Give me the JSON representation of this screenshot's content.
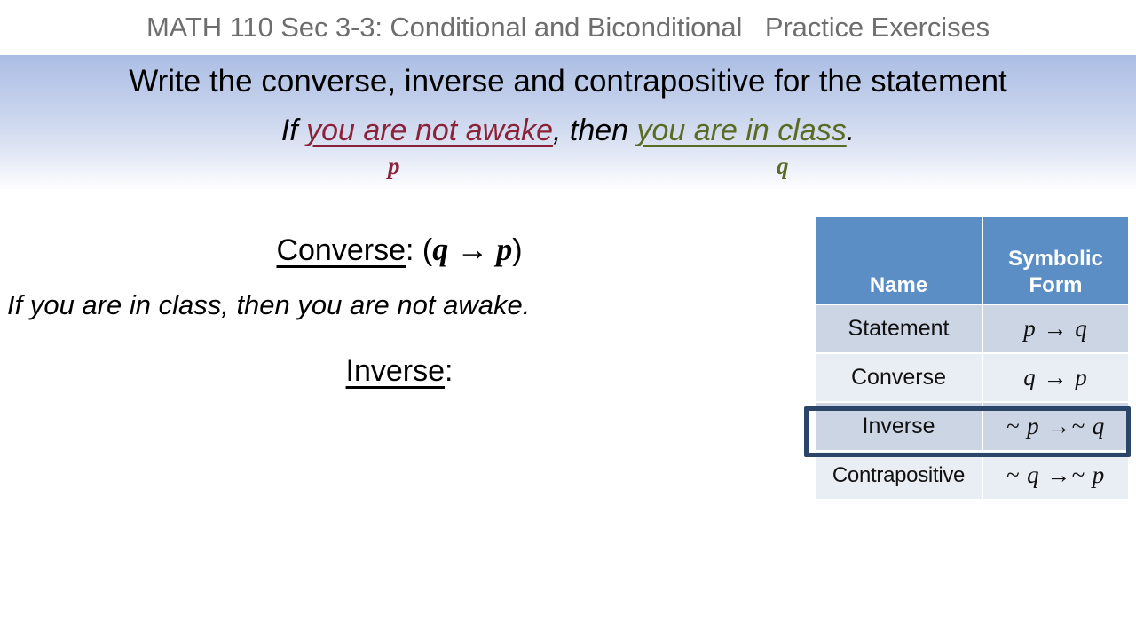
{
  "header": {
    "title": "MATH 110 Sec 3-3: Conditional and Biconditional   Practice Exercises"
  },
  "banner": {
    "instruction": "Write the converse, inverse and contrapositive for the statement",
    "statement": {
      "prefix": "If ",
      "p_phrase": "you are not awake",
      "middle": ", then ",
      "q_phrase": "you are in class",
      "suffix": ".",
      "p_label": "p",
      "q_label": "q",
      "p_color": "#8c2239",
      "q_color": "#5a6b23"
    }
  },
  "work": {
    "converse_label": "Converse",
    "converse_colon": ": (",
    "converse_sym_first": "q",
    "converse_sym_arrow": " → ",
    "converse_sym_second": "p",
    "converse_sym_close": ")",
    "converse_answer": "If you are in class, then you are not awake.",
    "inverse_label": "Inverse",
    "inverse_colon": ":"
  },
  "reference_table": {
    "headers": [
      "Name",
      "Symbolic Form"
    ],
    "header_bg": "#5b8ec4",
    "highlight_row": "Inverse",
    "highlight_color": "#2b4569",
    "rows": [
      {
        "name": "Statement",
        "symbolic": "p → q",
        "shade": "dark"
      },
      {
        "name": "Converse",
        "symbolic": "q → p",
        "shade": "light"
      },
      {
        "name": "Inverse",
        "symbolic": "~ p →~ q",
        "shade": "dark"
      },
      {
        "name": "Contrapositive",
        "symbolic": "~ q →~ p",
        "shade": "light"
      }
    ]
  }
}
